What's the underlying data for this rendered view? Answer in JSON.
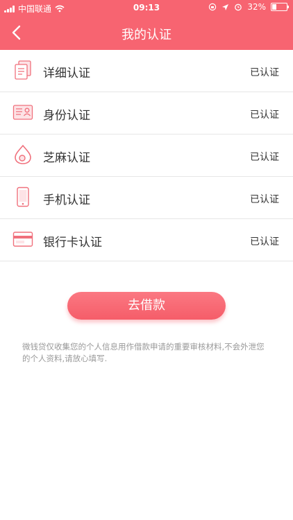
{
  "status_bar": {
    "carrier": "中国联通",
    "time": "09:13",
    "battery": "32%",
    "battery_level": 0.32
  },
  "header": {
    "title": "我的认证",
    "back_icon": "chevron-left-icon"
  },
  "items": [
    {
      "label": "详细认证",
      "status": "已认证",
      "icon": "document-icon"
    },
    {
      "label": "身份认证",
      "status": "已认证",
      "icon": "id-card-icon"
    },
    {
      "label": "芝麻认证",
      "status": "已认证",
      "icon": "sesame-icon"
    },
    {
      "label": "手机认证",
      "status": "已认证",
      "icon": "phone-icon"
    },
    {
      "label": "银行卡认证",
      "status": "已认证",
      "icon": "bank-card-icon"
    }
  ],
  "action": {
    "borrow_label": "去借款"
  },
  "footer_note": "微钱贷仅收集您的个人信息用作借款申请的重要审核材料,不会外泄您的个人资料,请放心填写.",
  "colors": {
    "accent": "#f76471",
    "icon": "#f0707c"
  }
}
